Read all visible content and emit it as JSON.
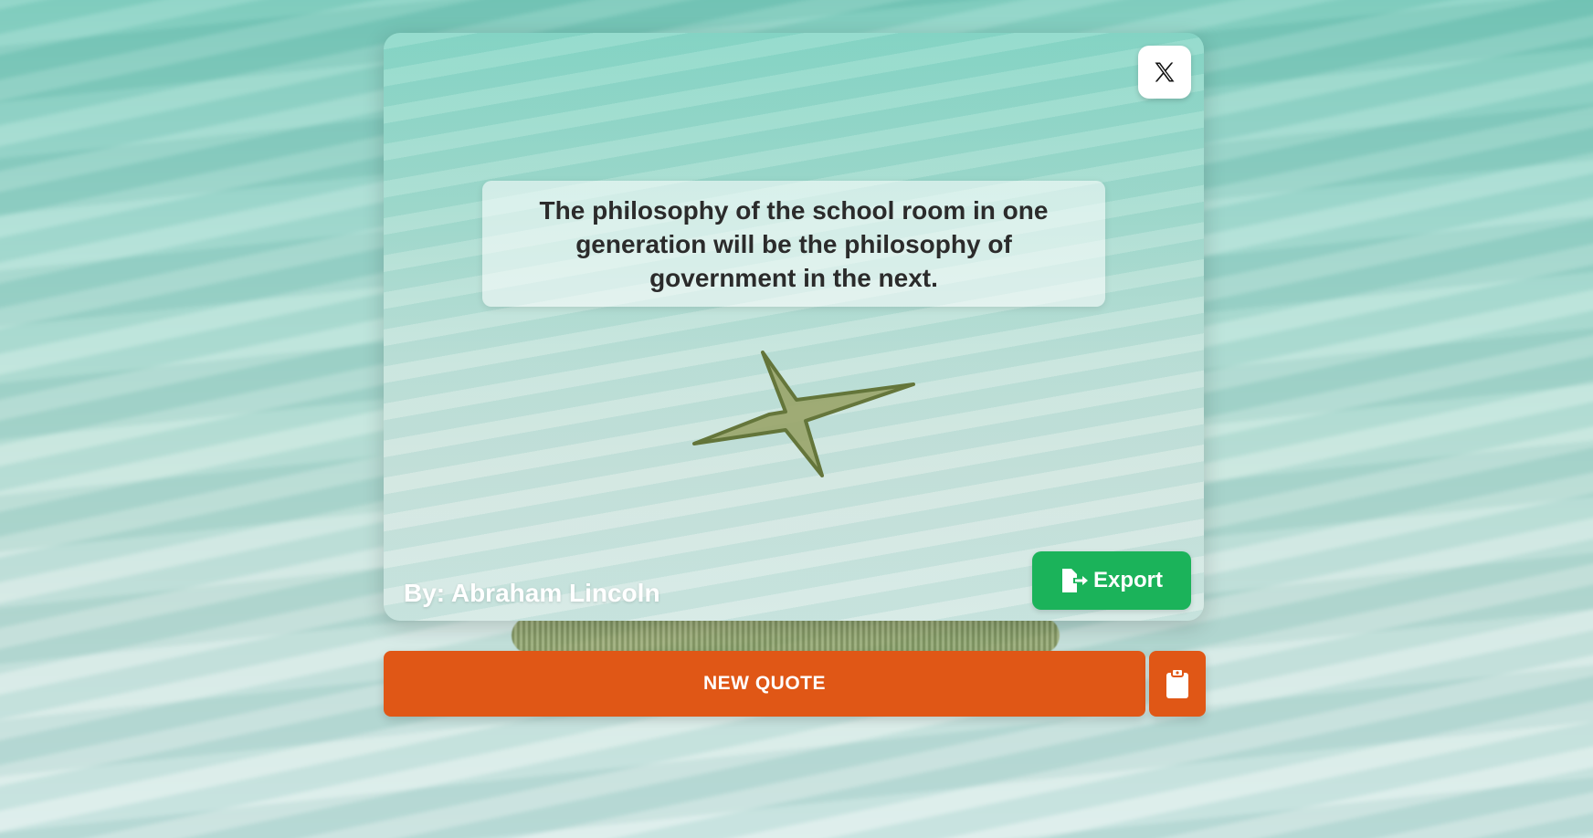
{
  "quote": {
    "text": "The philosophy of the school room in one generation will be the philosophy of government in the next.",
    "author_line": "By: Abraham Lincoln"
  },
  "actions": {
    "share_icon": "x-twitter-icon",
    "export_icon": "file-export-icon",
    "export_label": "Export",
    "new_quote_label": "NEW QUOTE",
    "copy_icon": "clipboard-icon"
  },
  "colors": {
    "new_quote_button": "#e05716",
    "export_button": "#1bb35a",
    "quote_text": "#2b2b2b",
    "author_text": "#ffffff"
  }
}
